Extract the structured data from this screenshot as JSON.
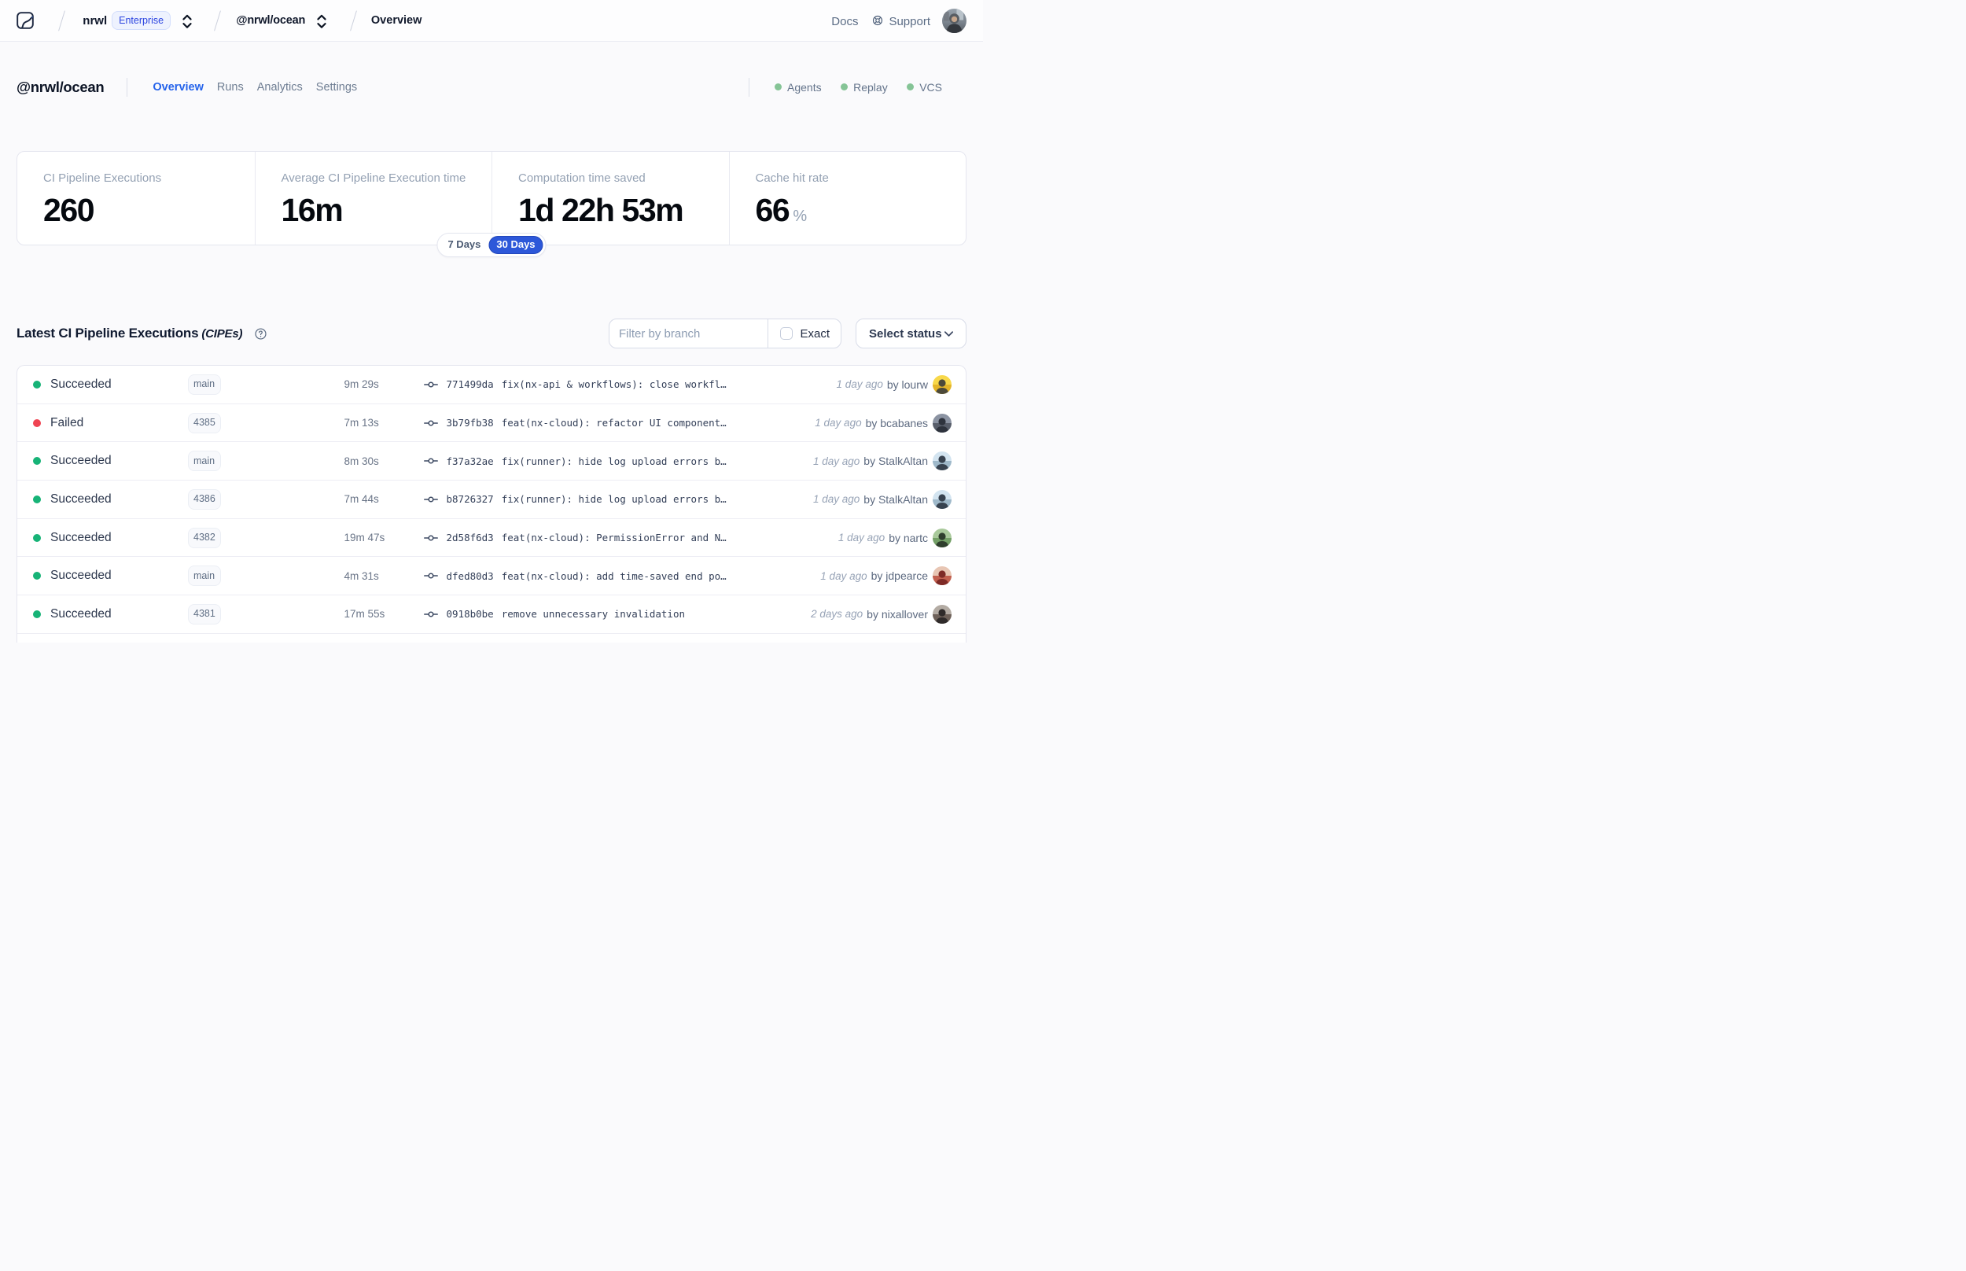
{
  "topbar": {
    "breadcrumb": {
      "org": "nrwl",
      "org_badge": "Enterprise",
      "workspace": "@nrwl/ocean",
      "page": "Overview"
    },
    "docs_label": "Docs",
    "support_label": "Support"
  },
  "header": {
    "title": "@nrwl/ocean",
    "tabs": [
      {
        "label": "Overview",
        "active": true
      },
      {
        "label": "Runs",
        "active": false
      },
      {
        "label": "Analytics",
        "active": false
      },
      {
        "label": "Settings",
        "active": false
      }
    ],
    "statuses": [
      {
        "label": "Agents",
        "color": "#85c496"
      },
      {
        "label": "Replay",
        "color": "#85c496"
      },
      {
        "label": "VCS",
        "color": "#85c496"
      }
    ]
  },
  "stats": {
    "cards": [
      {
        "label": "CI Pipeline Executions",
        "value": "260",
        "unit": ""
      },
      {
        "label": "Average CI Pipeline Execution time",
        "value": "16m",
        "unit": ""
      },
      {
        "label": "Computation time saved",
        "value": "1d 22h 53m",
        "unit": ""
      },
      {
        "label": "Cache hit rate",
        "value": "66",
        "unit": "%"
      }
    ],
    "range_toggle": {
      "options": [
        "7 Days",
        "30 Days"
      ],
      "selected": "30 Days",
      "active_color": "#2d58d9"
    }
  },
  "list": {
    "title": "Latest CI Pipeline Executions",
    "title_suffix": "(CIPEs)",
    "filter_placeholder": "Filter by branch",
    "filter_value": "",
    "exact_label": "Exact",
    "exact_checked": false,
    "status_select_label": "Select status",
    "rows": [
      {
        "status": "Succeeded",
        "status_color": "#17b377",
        "branch": "main",
        "duration": "9m 29s",
        "commit_hash": "771499da",
        "commit_message": "fix(nx-api & workflows): close workfl…",
        "time_ago": "1 day ago",
        "author": "by lourw",
        "avatar_colors": [
          "#f8d84a",
          "#e4b52b",
          "#4d4a3a"
        ]
      },
      {
        "status": "Failed",
        "status_color": "#ef4452",
        "branch": "4385",
        "duration": "7m 13s",
        "commit_hash": "3b79fb38",
        "commit_message": "feat(nx-cloud): refactor UI component…",
        "time_ago": "1 day ago",
        "author": "by bcabanes",
        "avatar_colors": [
          "#8b93a2",
          "#585e6a",
          "#2e333d"
        ]
      },
      {
        "status": "Succeeded",
        "status_color": "#17b377",
        "branch": "main",
        "duration": "8m 30s",
        "commit_hash": "f37a32ae",
        "commit_message": "fix(runner): hide log upload errors b…",
        "time_ago": "1 day ago",
        "author": "by StalkAltan",
        "avatar_colors": [
          "#d3e4f0",
          "#9fb9ca",
          "#37424f"
        ]
      },
      {
        "status": "Succeeded",
        "status_color": "#17b377",
        "branch": "4386",
        "duration": "7m 44s",
        "commit_hash": "b8726327",
        "commit_message": "fix(runner): hide log upload errors b…",
        "time_ago": "1 day ago",
        "author": "by StalkAltan",
        "avatar_colors": [
          "#d3e4f0",
          "#9fb9ca",
          "#37424f"
        ]
      },
      {
        "status": "Succeeded",
        "status_color": "#17b377",
        "branch": "4382",
        "duration": "19m 47s",
        "commit_hash": "2d58f6d3",
        "commit_message": "feat(nx-cloud): PermissionError and N…",
        "time_ago": "1 day ago",
        "author": "by nartc",
        "avatar_colors": [
          "#a9c99b",
          "#74a067",
          "#2f3e2d"
        ]
      },
      {
        "status": "Succeeded",
        "status_color": "#17b377",
        "branch": "main",
        "duration": "4m 31s",
        "commit_hash": "dfed80d3",
        "commit_message": "feat(nx-cloud): add time-saved end po…",
        "time_ago": "1 day ago",
        "author": "by jdpearce",
        "avatar_colors": [
          "#e8c6b4",
          "#c2604f",
          "#7e2a26"
        ]
      },
      {
        "status": "Succeeded",
        "status_color": "#17b377",
        "branch": "4381",
        "duration": "17m 55s",
        "commit_hash": "0918b0be",
        "commit_message": "remove unnecessary invalidation",
        "time_ago": "2 days ago",
        "author": "by nixallover",
        "avatar_colors": [
          "#b3aba3",
          "#6e6159",
          "#2f2b2a"
        ]
      }
    ]
  }
}
